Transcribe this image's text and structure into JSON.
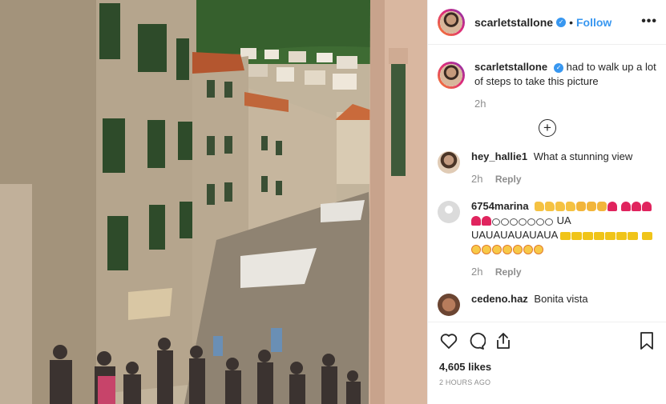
{
  "post": {
    "username": "scarletstallone",
    "follow_label": "Follow",
    "separator": "•",
    "more_label": "•••"
  },
  "caption": {
    "username": "scarletstallone",
    "text": "had to walk up a lot of steps to take this picture",
    "time": "2h"
  },
  "comments": [
    {
      "username": "hey_hallie1",
      "text": "What a stunning view",
      "time": "2h",
      "reply_label": "Reply"
    },
    {
      "username": "6754marina",
      "text": "UA UAUAUAUAUAUA",
      "time": "2h",
      "reply_label": "Reply"
    },
    {
      "username": "cedeno.haz",
      "text": "Bonita vista"
    }
  ],
  "actions": {
    "likes": "4,605 likes",
    "posted": "2 HOURS AGO"
  },
  "icons": {
    "like": "heart-icon",
    "comment": "comment-icon",
    "share": "share-icon",
    "save": "bookmark-icon",
    "load_more": "plus-circle-icon"
  }
}
